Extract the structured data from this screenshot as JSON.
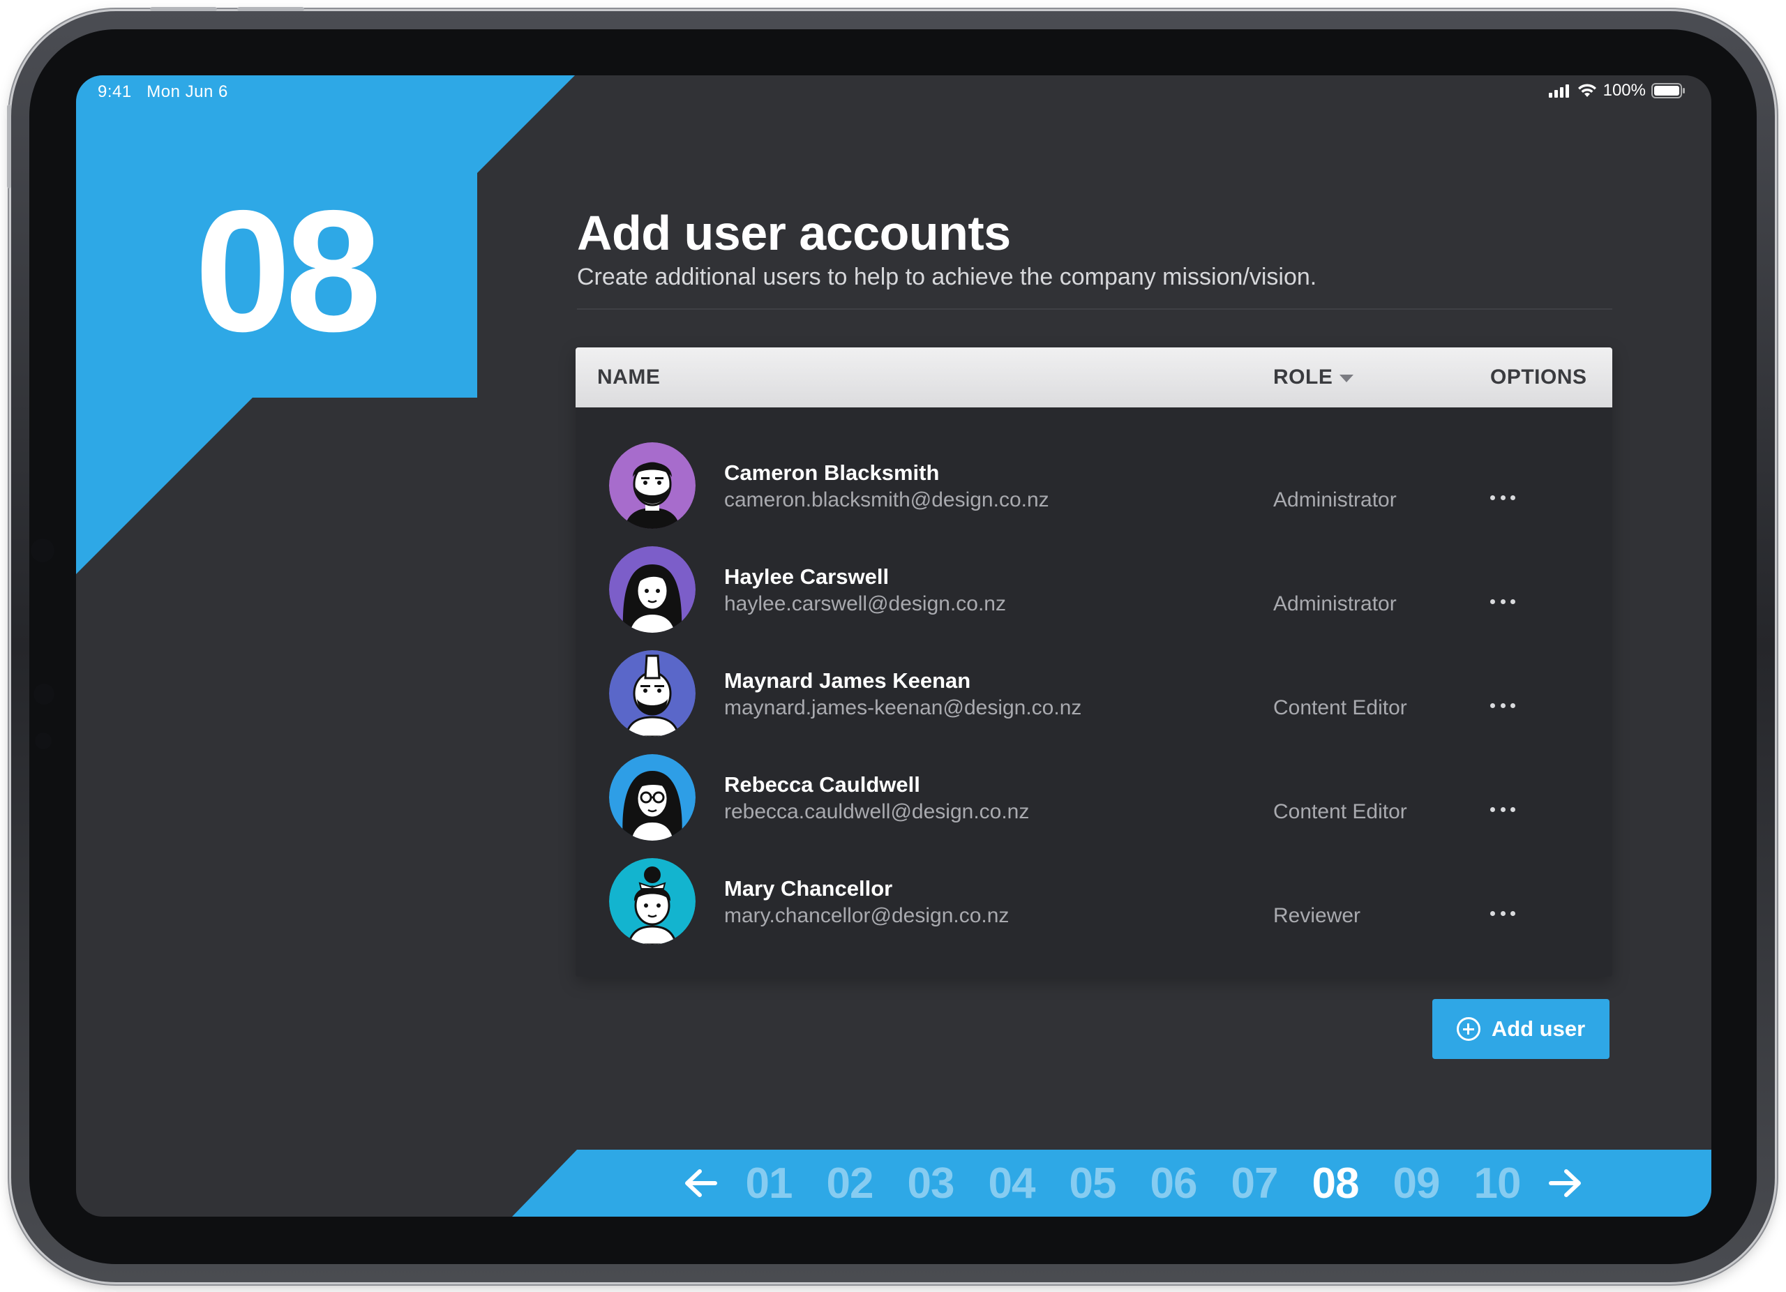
{
  "status_bar": {
    "time": "9:41",
    "date": "Mon Jun 6",
    "battery": "100%"
  },
  "step": {
    "number": "08"
  },
  "header": {
    "title": "Add user accounts",
    "subtitle": "Create additional users to help to achieve the company mission/vision."
  },
  "table": {
    "columns": {
      "name": "NAME",
      "role": "ROLE",
      "options": "OPTIONS"
    },
    "rows": [
      {
        "name": "Cameron Blacksmith",
        "email": "cameron.blacksmith@design.co.nz",
        "role": "Administrator",
        "avatar_color": "#a76ccc"
      },
      {
        "name": "Haylee Carswell",
        "email": "haylee.carswell@design.co.nz",
        "role": "Administrator",
        "avatar_color": "#7c5ec9"
      },
      {
        "name": "Maynard James Keenan",
        "email": "maynard.james-keenan@design.co.nz",
        "role": "Content Editor",
        "avatar_color": "#5a67c9"
      },
      {
        "name": "Rebecca Cauldwell",
        "email": "rebecca.cauldwell@design.co.nz",
        "role": "Content Editor",
        "avatar_color": "#2e9ee6"
      },
      {
        "name": "Mary Chancellor",
        "email": "mary.chancellor@design.co.nz",
        "role": "Reviewer",
        "avatar_color": "#13b4cf"
      }
    ]
  },
  "add_button": {
    "label": "Add user"
  },
  "pager": {
    "pages": [
      "01",
      "02",
      "03",
      "04",
      "05",
      "06",
      "07",
      "08",
      "09",
      "10"
    ],
    "active": "08"
  },
  "colors": {
    "accent": "#2ea8e6",
    "background": "#313236",
    "panel": "#28292d",
    "page_inactive": "#86ccf1"
  }
}
